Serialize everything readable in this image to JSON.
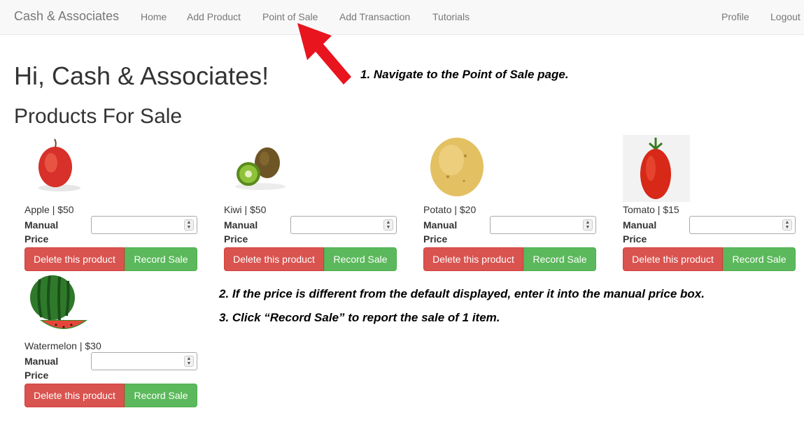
{
  "nav": {
    "brand": "Cash & Associates",
    "links": [
      "Home",
      "Add Product",
      "Point of Sale",
      "Add Transaction",
      "Tutorials"
    ],
    "right": [
      "Profile",
      "Logout"
    ]
  },
  "greeting": "Hi, Cash & Associates!",
  "section_title": "Products For Sale",
  "manual_price_label": "Manual Price",
  "delete_label": "Delete this product",
  "record_label": "Record Sale",
  "products": [
    {
      "name": "Apple | $50",
      "image": "apple"
    },
    {
      "name": "Kiwi | $50",
      "image": "kiwi"
    },
    {
      "name": "Potato | $20",
      "image": "potato"
    },
    {
      "name": "Tomato | $15",
      "image": "tomato"
    },
    {
      "name": "Watermelon | $30",
      "image": "watermelon"
    }
  ],
  "annotations": [
    "1. Navigate to the Point of Sale page.",
    "2. If the price is different from the default displayed, enter it into the manual price box.",
    "3. Click “Record Sale” to report the sale of 1 item."
  ],
  "colors": {
    "arrow": "#e8141e",
    "delete": "#d9534f",
    "record": "#5cb85c"
  }
}
